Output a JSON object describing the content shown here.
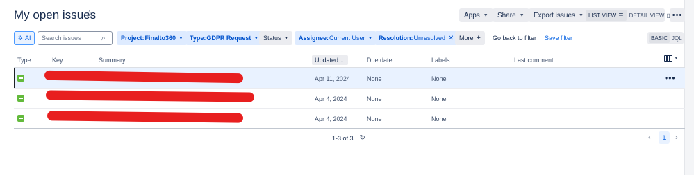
{
  "header": {
    "title": "My open issues",
    "star_icon": "star-icon",
    "apps_label": "Apps",
    "share_label": "Share",
    "export_label": "Export issues",
    "list_view_label": "LIST VIEW",
    "detail_view_label": "DETAIL VIEW",
    "more_label": "•••"
  },
  "filters": {
    "ai_label": "AI",
    "search_placeholder": "Search issues",
    "project": {
      "key": "Project:",
      "value": "Finalto360"
    },
    "type": {
      "key": "Type:",
      "value": "GDPR Request"
    },
    "status_label": "Status",
    "assignee": {
      "key": "Assignee:",
      "value": "Current User"
    },
    "resolution": {
      "key": "Resolution:",
      "value": "Unresolved"
    },
    "more_label": "More",
    "go_back_label": "Go back to filter",
    "save_filter_label": "Save filter",
    "basic_label": "BASIC",
    "jql_label": "JQL"
  },
  "table": {
    "columns": {
      "type": "Type",
      "key": "Key",
      "summary": "Summary",
      "updated": "Updated",
      "due_date": "Due date",
      "labels": "Labels",
      "last_comment": "Last comment"
    },
    "rows": [
      {
        "updated": "Apr 11, 2024",
        "due_date": "None",
        "labels": "None",
        "selected": true
      },
      {
        "updated": "Apr 4, 2024",
        "due_date": "None",
        "labels": "None",
        "selected": false
      },
      {
        "updated": "Apr 4, 2024",
        "due_date": "None",
        "labels": "None",
        "selected": false
      }
    ],
    "row_menu_label": "•••"
  },
  "footer": {
    "count_label": "1-3 of 3",
    "current_page": "1"
  },
  "colors": {
    "accent": "#0c66e4",
    "story_type": "#63ba3c",
    "redaction": "#e81f1f"
  }
}
